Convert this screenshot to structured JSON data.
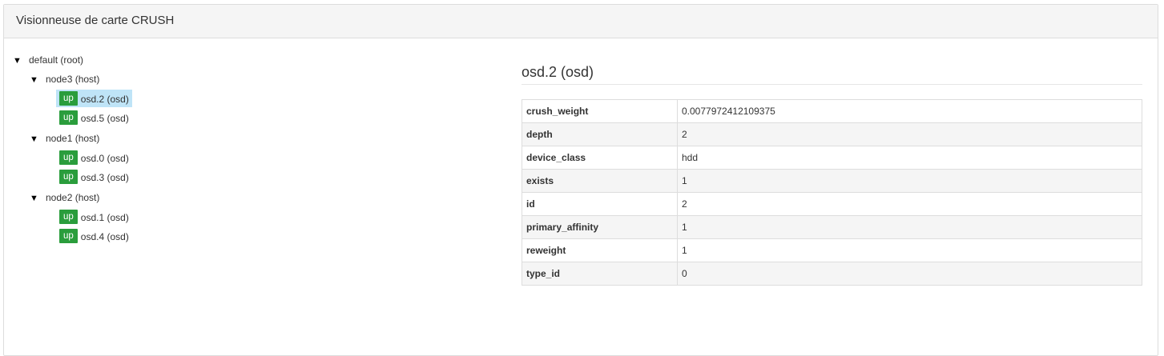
{
  "panel": {
    "title": "Visionneuse de carte CRUSH"
  },
  "tree": {
    "root": {
      "toggle": "▼",
      "label": "default (root)"
    },
    "hosts": [
      {
        "toggle": "▼",
        "label": "node3 (host)",
        "osds": [
          {
            "status": "up",
            "label": "osd.2 (osd)",
            "selected": true
          },
          {
            "status": "up",
            "label": "osd.5 (osd)",
            "selected": false
          }
        ]
      },
      {
        "toggle": "▼",
        "label": "node1 (host)",
        "osds": [
          {
            "status": "up",
            "label": "osd.0 (osd)",
            "selected": false
          },
          {
            "status": "up",
            "label": "osd.3 (osd)",
            "selected": false
          }
        ]
      },
      {
        "toggle": "▼",
        "label": "node2 (host)",
        "osds": [
          {
            "status": "up",
            "label": "osd.1 (osd)",
            "selected": false
          },
          {
            "status": "up",
            "label": "osd.4 (osd)",
            "selected": false
          }
        ]
      }
    ]
  },
  "detail": {
    "title": "osd.2 (osd)",
    "rows": [
      {
        "key": "crush_weight",
        "value": "0.0077972412109375"
      },
      {
        "key": "depth",
        "value": "2"
      },
      {
        "key": "device_class",
        "value": "hdd"
      },
      {
        "key": "exists",
        "value": "1"
      },
      {
        "key": "id",
        "value": "2"
      },
      {
        "key": "primary_affinity",
        "value": "1"
      },
      {
        "key": "reweight",
        "value": "1"
      },
      {
        "key": "type_id",
        "value": "0"
      }
    ]
  },
  "colors": {
    "badge_up": "#2a9d3c",
    "selected_bg": "#bfe4f7"
  }
}
